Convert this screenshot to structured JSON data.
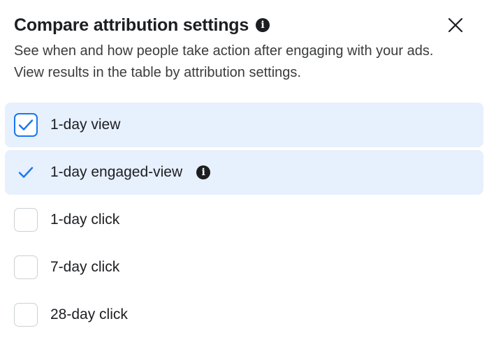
{
  "dialog": {
    "title": "Compare attribution settings",
    "description": "See when and how people take action after engaging with your ads. View results in the table by attribution settings.",
    "close_icon": "close-icon",
    "info_icon": "info-icon"
  },
  "options": [
    {
      "label": "1-day view",
      "checked": true
    },
    {
      "label": "1-day engaged-view",
      "checked": true,
      "has_info": true
    },
    {
      "label": "1-day click",
      "checked": false
    },
    {
      "label": "7-day click",
      "checked": false
    },
    {
      "label": "28-day click",
      "checked": false
    }
  ],
  "colors": {
    "accent": "#1877f2",
    "selected_row_bg": "#e7f0fd",
    "text": "#1c1e21",
    "border": "#ccd0d5"
  }
}
